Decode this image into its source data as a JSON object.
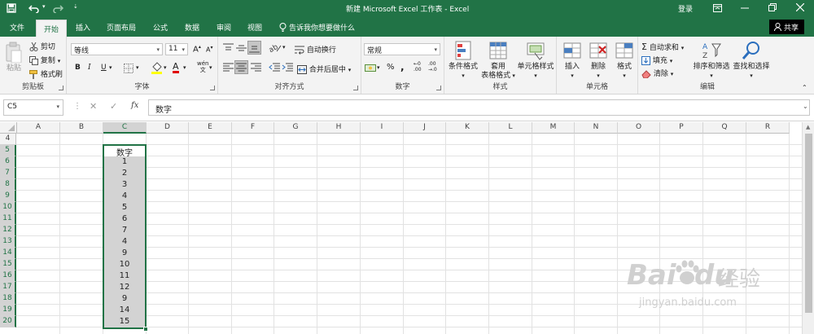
{
  "titlebar": {
    "title": "新建 Microsoft Excel 工作表 - Excel",
    "login": "登录",
    "save_icon": "save-icon",
    "undo_icon": "undo-icon",
    "redo_icon": "redo-icon"
  },
  "tabs": [
    {
      "label": "文件",
      "active": false
    },
    {
      "label": "开始",
      "active": true
    },
    {
      "label": "插入",
      "active": false
    },
    {
      "label": "页面布局",
      "active": false
    },
    {
      "label": "公式",
      "active": false
    },
    {
      "label": "数据",
      "active": false
    },
    {
      "label": "审阅",
      "active": false
    },
    {
      "label": "视图",
      "active": false
    }
  ],
  "tell_me": "告诉我你想要做什么",
  "share": "共享",
  "ribbon": {
    "clipboard": {
      "paste": "粘贴",
      "cut": "剪切",
      "copy": "复制",
      "format_painter": "格式刷",
      "label": "剪贴板"
    },
    "font": {
      "name": "等线",
      "size": "11",
      "grow": "A",
      "shrink": "A",
      "bold": "B",
      "italic": "I",
      "underline": "U",
      "font_color": "A",
      "phonetic": "wén",
      "label": "字体"
    },
    "alignment": {
      "wrap": "自动换行",
      "merge": "合并后居中",
      "label": "对齐方式"
    },
    "number": {
      "format": "常规",
      "percent": "%",
      "comma": ",",
      "label": "数字"
    },
    "styles": {
      "conditional": "条件格式",
      "table_line1": "套用",
      "table_line2": "表格格式",
      "cell_styles": "单元格样式",
      "label": "样式"
    },
    "cells": {
      "insert": "插入",
      "delete": "删除",
      "format": "格式",
      "label": "单元格"
    },
    "editing": {
      "autosum": "自动求和",
      "fill": "填充",
      "clear": "清除",
      "sort": "排序和筛选",
      "find": "查找和选择",
      "label": "编辑"
    }
  },
  "formula_bar": {
    "name_box": "C5",
    "cancel": "✕",
    "enter": "✓",
    "fx": "fx",
    "content": "数字"
  },
  "columns": [
    "A",
    "B",
    "C",
    "D",
    "E",
    "F",
    "G",
    "H",
    "I",
    "J",
    "K",
    "L",
    "M",
    "N",
    "O",
    "P",
    "Q",
    "R"
  ],
  "selected_column": "C",
  "rows": [
    "4",
    "5",
    "6",
    "7",
    "8",
    "9",
    "10",
    "11",
    "12",
    "13",
    "14",
    "15",
    "16",
    "17",
    "18",
    "19",
    "20"
  ],
  "cells_c": [
    "",
    "数字",
    "1",
    "2",
    "3",
    "4",
    "5",
    "6",
    "7",
    "4",
    "9",
    "10",
    "11",
    "12",
    "9",
    "14",
    "15"
  ],
  "watermark": {
    "main": "Bai",
    "du": "du",
    "jy": "经验",
    "url": "jingyan.baidu.com"
  },
  "colors": {
    "accent": "#217346",
    "selection_fill": "#d3d3d3",
    "header_bg": "#f3f3f3"
  }
}
